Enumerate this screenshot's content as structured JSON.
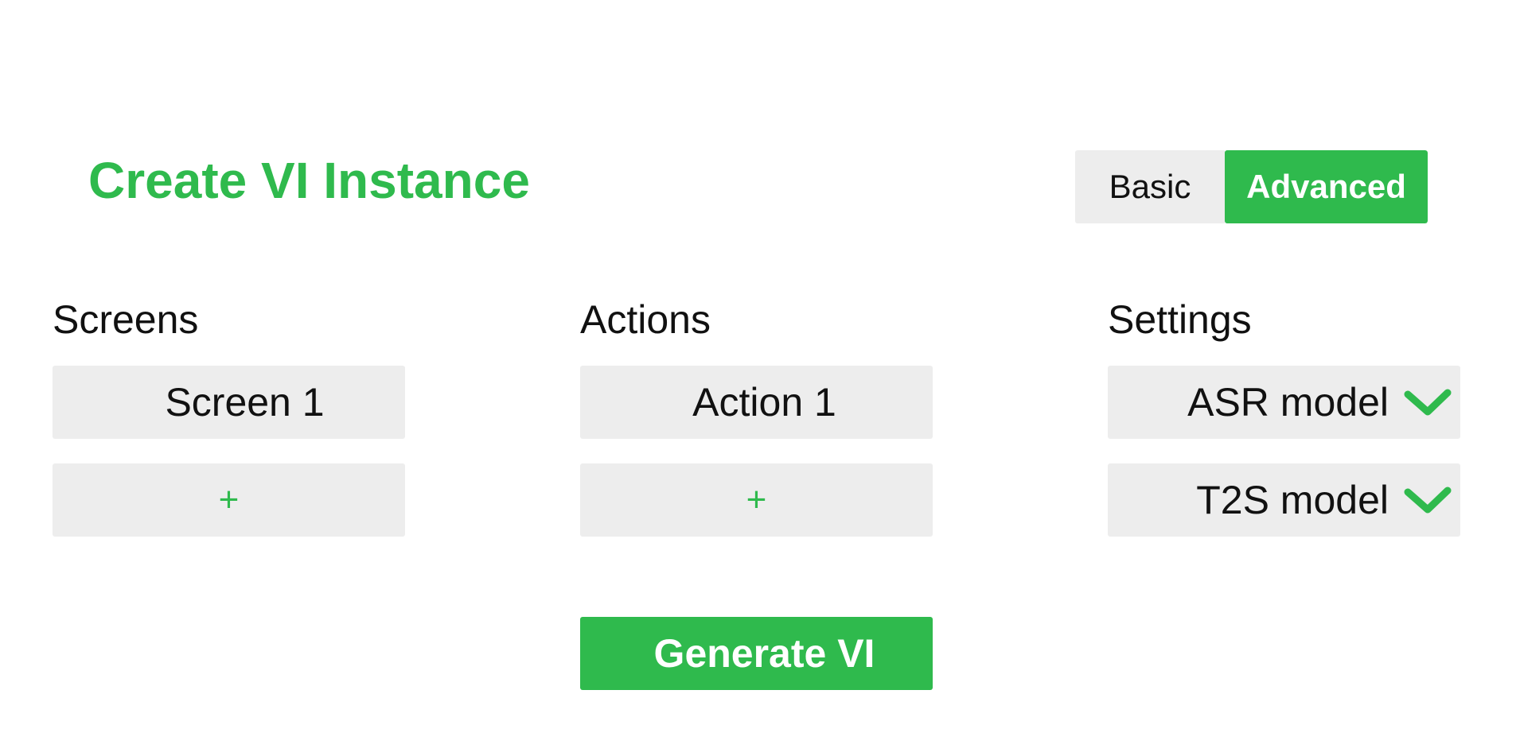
{
  "page": {
    "title": "Create VI Instance"
  },
  "mode_toggle": {
    "basic_label": "Basic",
    "advanced_label": "Advanced",
    "selected": "Advanced"
  },
  "columns": {
    "screens": {
      "heading": "Screens",
      "items": [
        {
          "label": "Screen 1"
        }
      ],
      "add_label": "+"
    },
    "actions": {
      "heading": "Actions",
      "items": [
        {
          "label": "Action 1"
        }
      ],
      "add_label": "+"
    },
    "settings": {
      "heading": "Settings",
      "selects": [
        {
          "label": "ASR model",
          "icon": "chevron-down-icon"
        },
        {
          "label": "T2S model",
          "icon": "chevron-down-icon"
        }
      ]
    }
  },
  "generate_button": {
    "label": "Generate VI"
  },
  "colors": {
    "accent": "#2fba4d",
    "tile_background": "#ededed",
    "text": "#111111",
    "background": "#ffffff"
  }
}
